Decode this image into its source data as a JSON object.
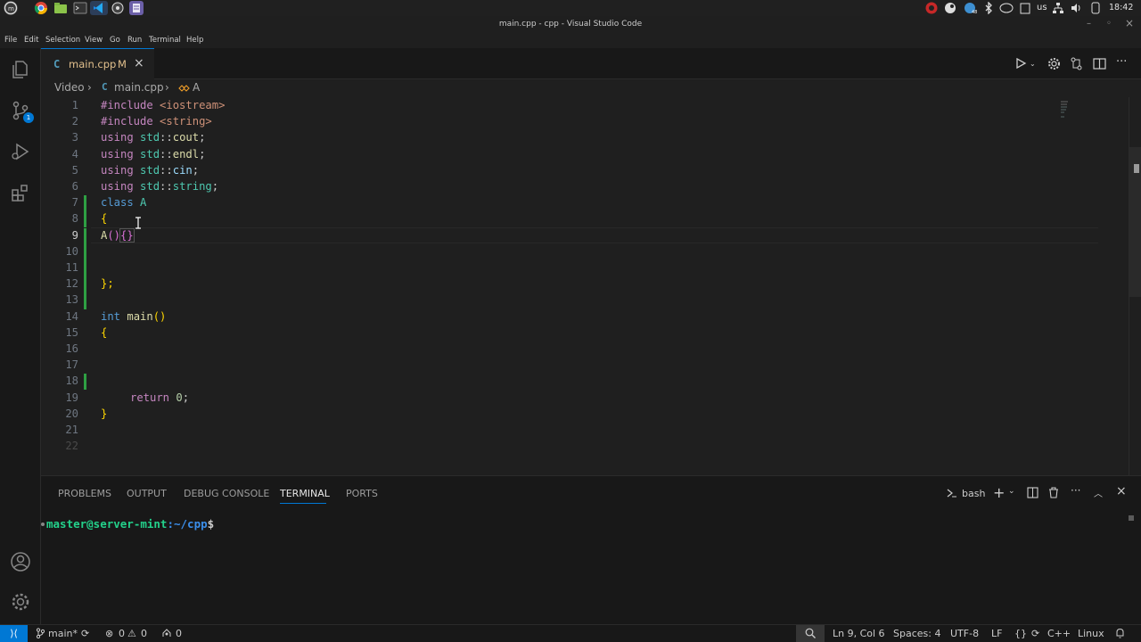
{
  "os": {
    "tray_lang": "us",
    "tray_steam_badge": "48",
    "time": "18:42"
  },
  "window": {
    "title": "main.cpp - cpp - Visual Studio Code",
    "min": "–",
    "max": "◦",
    "close": "×"
  },
  "menu": [
    "File",
    "Edit",
    "Selection",
    "View",
    "Go",
    "Run",
    "Terminal",
    "Help"
  ],
  "activity": {
    "scm_badge": "1"
  },
  "tab": {
    "icon": "C",
    "label": "main.cpp",
    "modified": "M",
    "close": "×"
  },
  "breadcrumb": {
    "folder": "Video",
    "file": "main.cpp",
    "symbol": "A",
    "sep": "›"
  },
  "editor": {
    "active_line": 9,
    "lines": [
      {
        "n": "1"
      },
      {
        "n": "2"
      },
      {
        "n": "3"
      },
      {
        "n": "4"
      },
      {
        "n": "5"
      },
      {
        "n": "6"
      },
      {
        "n": "7"
      },
      {
        "n": "8"
      },
      {
        "n": "9"
      },
      {
        "n": "10"
      },
      {
        "n": "11"
      },
      {
        "n": "12"
      },
      {
        "n": "13"
      },
      {
        "n": "14"
      },
      {
        "n": "15"
      },
      {
        "n": "16"
      },
      {
        "n": "17"
      },
      {
        "n": "18"
      },
      {
        "n": "19"
      },
      {
        "n": "20"
      },
      {
        "n": "21"
      },
      {
        "n": "22"
      }
    ],
    "tokens": {
      "include": "#include",
      "iostream": "<iostream>",
      "string_hdr": "<string>",
      "using": "using",
      "std": "std",
      "scope": "::",
      "cout": "cout",
      "endl": "endl",
      "cin": "cin",
      "string": "string",
      "semi": ";",
      "class": "class",
      "A": "A",
      "lbrace": "{",
      "rbrace": "}",
      "ctor_paren": "()",
      "ctor_braces": "{}",
      "close_class": "};",
      "int": "int",
      "main": "main",
      "paren": "()",
      "return": "return",
      "zero": "0"
    }
  },
  "panel": {
    "tabs": [
      "PROBLEMS",
      "OUTPUT",
      "DEBUG CONSOLE",
      "TERMINAL",
      "PORTS"
    ],
    "active_tab": "TERMINAL",
    "shell": "bash",
    "prompt_user": "master@server-mint",
    "prompt_path": ":~/cpp",
    "prompt_end": "$"
  },
  "status": {
    "branch": "main*",
    "errors": "0",
    "warnings": "0",
    "ports": "0",
    "position": "Ln 9, Col 6",
    "spaces": "Spaces: 4",
    "encoding": "UTF-8",
    "eol": "LF",
    "braces": "{}",
    "language": "C++",
    "os": "Linux"
  },
  "colors": {
    "accent": "#0078d4",
    "modified": "#e2c08d",
    "added_gutter": "#2ea043",
    "prompt_green": "#23d18b",
    "prompt_blue": "#3b8eea"
  }
}
